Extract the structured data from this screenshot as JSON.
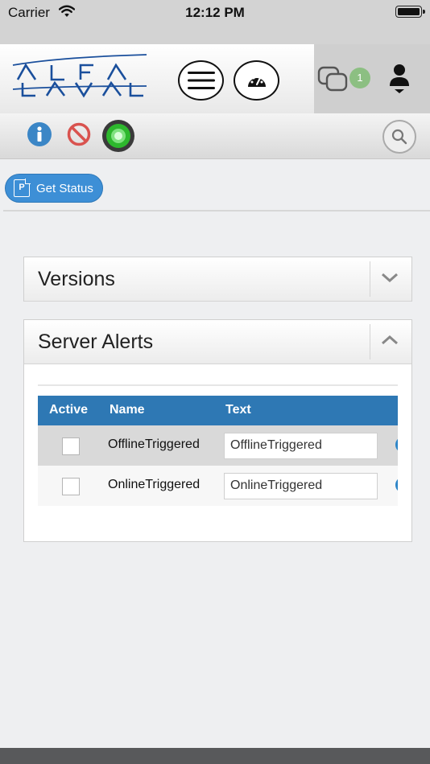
{
  "status_bar": {
    "carrier": "Carrier",
    "time": "12:12 PM",
    "wifi_icon": "wifi-icon",
    "battery_icon": "battery-icon"
  },
  "header": {
    "logo_text": "ALFA LAVAL",
    "menu_icon": "hamburger-menu-icon",
    "dashboard_icon": "speedometer-icon",
    "chat_icon": "chat-bubbles-icon",
    "chat_badge": "1",
    "user_icon": "user-icon",
    "colors": {
      "logo": "#1a4f9c",
      "badge": "#8cbf82"
    }
  },
  "toolbar": {
    "icons": [
      "info-icon",
      "blocked-icon",
      "status-ok-icon"
    ],
    "search_icon": "search-icon",
    "colors": {
      "info": "#3b86c6",
      "blocked": "#d9534f",
      "status": "#2db82d"
    }
  },
  "actions": {
    "get_status_label": "Get Status",
    "get_status_icon": "pdf-document-icon",
    "color": "#3d8fd6"
  },
  "panels": {
    "versions": {
      "title": "Versions",
      "expanded": false
    },
    "server_alerts": {
      "title": "Server Alerts",
      "expanded": true,
      "table": {
        "columns": [
          "Active",
          "Name",
          "Text"
        ],
        "rows": [
          {
            "active": false,
            "name": "OfflineTriggered",
            "text": "OfflineTriggered"
          },
          {
            "active": false,
            "name": "OnlineTriggered",
            "text": "OnlineTriggered"
          }
        ],
        "header_color": "#2e78b4"
      }
    }
  }
}
